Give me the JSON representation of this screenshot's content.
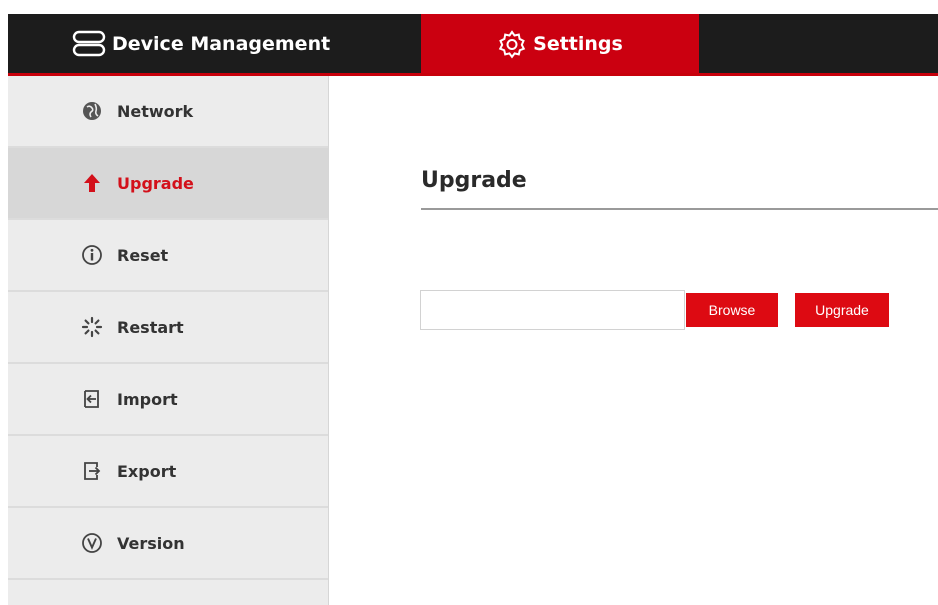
{
  "header": {
    "tabs": [
      {
        "label": "Device Management",
        "icon": "device-stack-icon"
      },
      {
        "label": "Settings",
        "icon": "gear-icon",
        "active": true
      }
    ]
  },
  "sidebar": {
    "items": [
      {
        "label": "Network",
        "icon": "globe-icon"
      },
      {
        "label": "Upgrade",
        "icon": "arrow-up-icon",
        "active": true
      },
      {
        "label": "Reset",
        "icon": "info-circle-icon"
      },
      {
        "label": "Restart",
        "icon": "spinner-icon"
      },
      {
        "label": "Import",
        "icon": "import-icon"
      },
      {
        "label": "Export",
        "icon": "export-icon"
      },
      {
        "label": "Version",
        "icon": "version-icon"
      }
    ]
  },
  "main": {
    "title": "Upgrade",
    "file_input": {
      "value": "",
      "placeholder": ""
    },
    "browse_label": "Browse",
    "upgrade_label": "Upgrade"
  },
  "colors": {
    "accent": "#cb0010",
    "topbar": "#1c1c1c",
    "sidebar_bg": "#ececec",
    "sidebar_active_bg": "#d7d7d7",
    "active_text": "#d3101a"
  }
}
